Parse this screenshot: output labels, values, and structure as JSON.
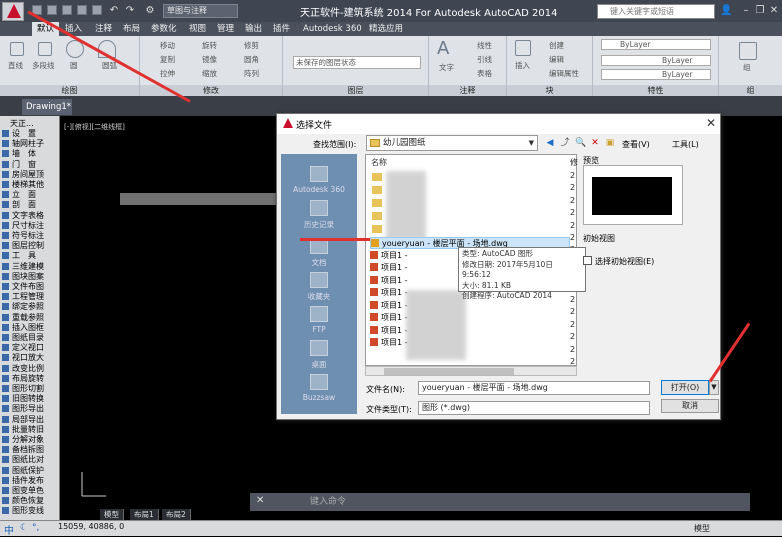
{
  "title_bar": {
    "window_title": "天正软件-建筑系统 2014  For Autodesk AutoCAD 2014",
    "workspace": "草图与注释",
    "search_placeholder": "键入关键字或短语"
  },
  "ribbon_tabs": [
    "默认",
    "插入",
    "注释",
    "布局",
    "参数化",
    "视图",
    "管理",
    "输出",
    "插件",
    "Autodesk 360",
    "精选应用"
  ],
  "ribbon": {
    "panels": [
      "绘图",
      "修改",
      "图层",
      "注释",
      "块",
      "特性",
      "组"
    ],
    "draw_tools": [
      "直线",
      "多段线",
      "圆",
      "圆弧"
    ],
    "modify_tools": [
      "移动",
      "旋转",
      "修剪",
      "复制",
      "镜像",
      "圆角",
      "拉伸",
      "缩放",
      "阵列"
    ],
    "layer_state": "未保存的图层状态",
    "annotation_tools": [
      "文字",
      "线性",
      "引线",
      "表格"
    ],
    "block_tools": [
      "插入",
      "创建",
      "编辑",
      "编辑属性"
    ],
    "properties": {
      "color": "ByLayer",
      "linetype": "ByLayer",
      "lineweight": "ByLayer"
    },
    "group_label": "组"
  },
  "document_tab": "Drawing1*",
  "viewport_label": "[-][俯视][二维线框]",
  "tianzheng_palette": {
    "title": "天正...",
    "items": [
      "设　置",
      "轴网柱子",
      "墙　体",
      "门　窗",
      "房间屋顶",
      "楼梯其他",
      "立　面",
      "剖　面",
      "文字表格",
      "尺寸标注",
      "符号标注",
      "图层控制",
      "工　具",
      "三维建模",
      "图块图案",
      "文件布图",
      "工程管理",
      "绑定参照",
      "重载参照",
      "插入图框",
      "图纸目录",
      "定义视口",
      "视口放大",
      "改变比例",
      "布局旋转",
      "图形切割",
      "旧图转换",
      "图形导出",
      "局部导出",
      "批量转旧",
      "分解对象",
      "备档拆图",
      "图纸比对",
      "图纸保护",
      "插件发布",
      "图变单色",
      "颜色恢复",
      "图形变线"
    ]
  },
  "dialog": {
    "title": "选择文件",
    "look_in_label": "查找范围(I):",
    "look_in_value": "幼儿园图纸",
    "view_menu": "查看(V)",
    "tools_menu": "工具(L)",
    "places": [
      "Autodesk 360",
      "历史记录",
      "文档",
      "收藏夹",
      "FTP",
      "桌面",
      "Buzzsaw"
    ],
    "column_name": "名称",
    "column_date": "修",
    "files": [
      {
        "name": "youeryuan - 楼层平面 - 场地.dwg",
        "selected": true
      },
      {
        "name": "项目1 - ",
        "selected": false
      },
      {
        "name": "项目1 - ",
        "selected": false
      },
      {
        "name": "项目1 - ",
        "selected": false
      },
      {
        "name": "项目1 - ",
        "selected": false
      },
      {
        "name": "项目1 - ",
        "selected": false
      },
      {
        "name": "项目1 - ",
        "selected": false
      },
      {
        "name": "项目1 - ",
        "selected": false
      },
      {
        "name": "项目1 - ",
        "selected": false
      }
    ],
    "date_col_values": [
      "2",
      "2",
      "2",
      "2",
      "2",
      "2",
      "2",
      "2",
      "2",
      "2",
      "2",
      "2",
      "2",
      "2",
      "2",
      "2"
    ],
    "tooltip": [
      "类型: AutoCAD 图形",
      "修改日期: 2017年5月10日 9:56:12",
      "大小: 81.1 KB",
      "创建程序: AutoCAD 2014"
    ],
    "preview_label": "预览",
    "initial_view_label": "初始视图",
    "initial_view_checkbox": "选择初始视图(E)",
    "filename_label": "文件名(N):",
    "filename_value": "youeryuan - 楼层平面 - 场地.dwg",
    "filetype_label": "文件类型(T):",
    "filetype_value": "图形 (*.dwg)",
    "open_button": "打开(O)",
    "cancel_button": "取消"
  },
  "command_line": {
    "placeholder": "键入命令",
    "close": "✕"
  },
  "layout_tabs": [
    "模型",
    "布局1",
    "布局2"
  ],
  "status_bar": {
    "coordinates": "15059, 40886, 0",
    "ime": "中",
    "model": "模型"
  },
  "accent_colors": {
    "annotation_arrow": "#e03030",
    "autocad_red": "#c8102e",
    "places_bar": "#6e8fb0"
  }
}
